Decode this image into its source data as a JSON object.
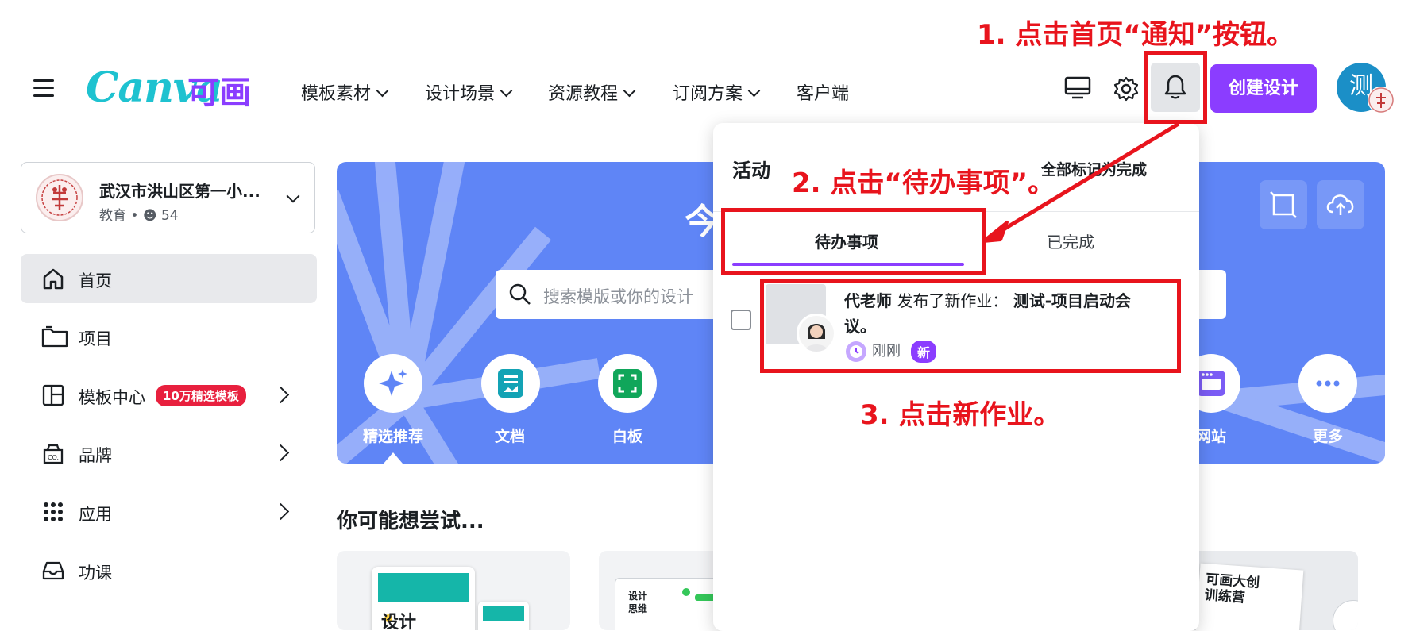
{
  "header": {
    "logo_text": "Canva",
    "logo_cn": "可画",
    "nav": [
      {
        "label": "模板素材",
        "has_dropdown": true
      },
      {
        "label": "设计场景",
        "has_dropdown": true
      },
      {
        "label": "资源教程",
        "has_dropdown": true
      },
      {
        "label": "订阅方案",
        "has_dropdown": true
      },
      {
        "label": "客户端",
        "has_dropdown": false
      }
    ],
    "create_button": "创建设计",
    "avatar_initial": "测",
    "icons": [
      "desktop-icon",
      "gear-icon",
      "bell-icon"
    ]
  },
  "sidebar": {
    "team": {
      "name": "武汉市洪山区第一小...",
      "category": "教育",
      "members": "54"
    },
    "items": [
      {
        "label": "首页",
        "icon": "home-icon",
        "active": true
      },
      {
        "label": "项目",
        "icon": "folder-icon"
      },
      {
        "label": "模板中心",
        "icon": "template-icon",
        "badge": "10万精选模板"
      },
      {
        "label": "品牌",
        "icon": "brand-icon"
      },
      {
        "label": "应用",
        "icon": "apps-icon"
      },
      {
        "label": "功课",
        "icon": "inbox-icon"
      }
    ]
  },
  "banner": {
    "title_fragment": "今",
    "search_placeholder": "搜索模版或你的设计",
    "shortcuts": [
      {
        "label": "精选推荐",
        "icon": "sparkle-icon"
      },
      {
        "label": "文档",
        "icon": "doc-icon"
      },
      {
        "label": "白板",
        "icon": "whiteboard-icon"
      },
      {
        "label": "网站",
        "icon": "website-icon"
      },
      {
        "label": "更多",
        "icon": "more-icon"
      }
    ]
  },
  "suggestions": {
    "title": "你可能想尝试...",
    "card1_text": "设计",
    "card2_text": "设计\n思维",
    "card4_text": "可画大创\n训练营"
  },
  "notifications": {
    "title": "活动",
    "mark_all": "全部标记为完成",
    "tabs": [
      {
        "label": "待办事项",
        "active": true
      },
      {
        "label": "已完成",
        "active": false
      }
    ],
    "items": [
      {
        "actor": "代老师",
        "action": "发布了新作业：",
        "target": "测试-项目启动会议。",
        "time": "刚刚",
        "badge": "新"
      }
    ]
  },
  "annotations": {
    "step1": "1. 点击首页“通知”按钮。",
    "step2": "2. 点击“待办事项”。",
    "step3": "3. 点击新作业。",
    "color": "#e8141d"
  },
  "colors": {
    "brand_purple": "#8b3dff",
    "banner_blue": "#5f85f6",
    "badge_red": "#e8203e"
  }
}
